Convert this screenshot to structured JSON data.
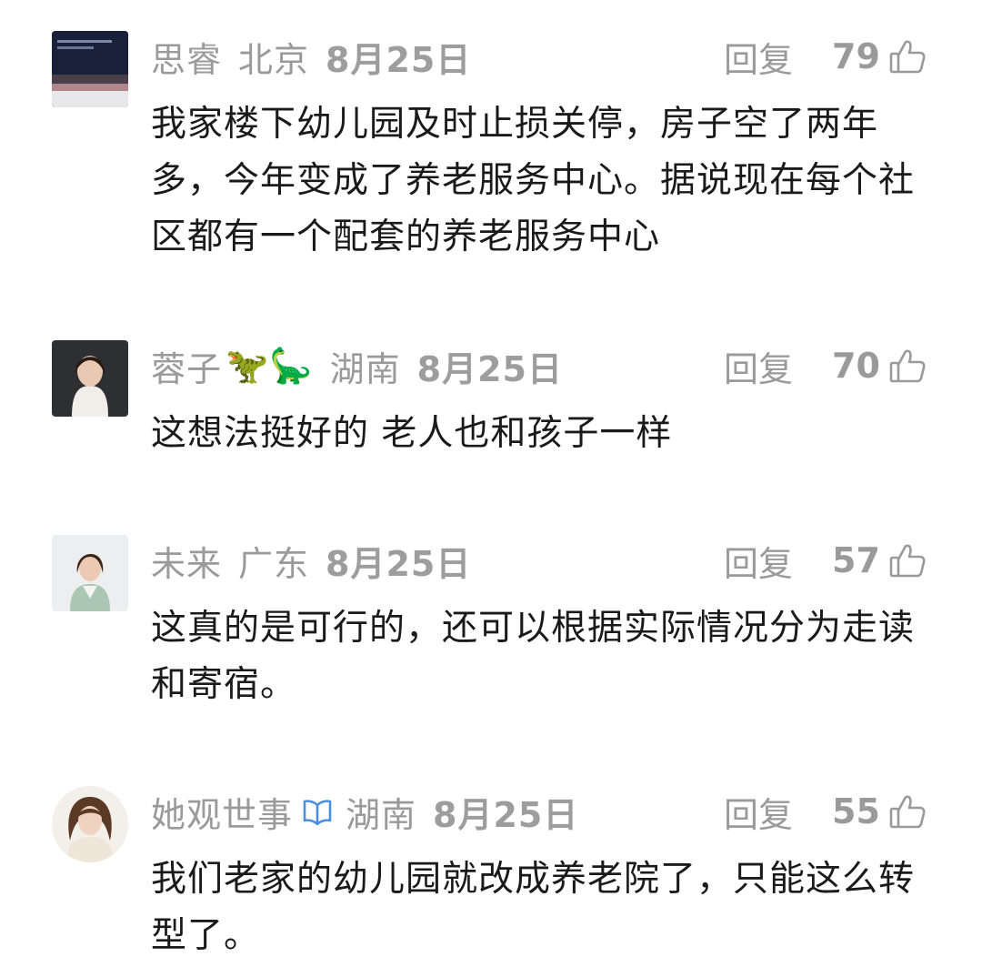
{
  "comments": [
    {
      "user": "思睿",
      "location": "北京",
      "date": "8月25日",
      "reply_label": "回复",
      "likes": "79",
      "text": "我家楼下幼儿园及时止损关停，房子空了两年多，今年变成了养老服务中心。据说现在每个社区都有一个配套的养老服务中心"
    },
    {
      "user": "蓉子",
      "user_emoji": "🦖🦕",
      "location": "湖南",
      "date": "8月25日",
      "reply_label": "回复",
      "likes": "70",
      "text": "这想法挺好的 老人也和孩子一样"
    },
    {
      "user": "未来",
      "location": "广东",
      "date": "8月25日",
      "reply_label": "回复",
      "likes": "57",
      "text": "这真的是可行的，还可以根据实际情况分为走读和寄宿。"
    },
    {
      "user": "她观世事",
      "location": "湖南",
      "date": "8月25日",
      "reply_label": "回复",
      "likes": "55",
      "text": "我们老家的幼儿园就改成养老院了，只能这么转型了。"
    }
  ],
  "icons": {
    "like": "thumbs-up-icon",
    "verified": "verified-badge-icon"
  },
  "colors": {
    "meta_text": "#9a9a9a",
    "body_text": "#1a1a1a",
    "verified_badge": "#4a90e2"
  }
}
